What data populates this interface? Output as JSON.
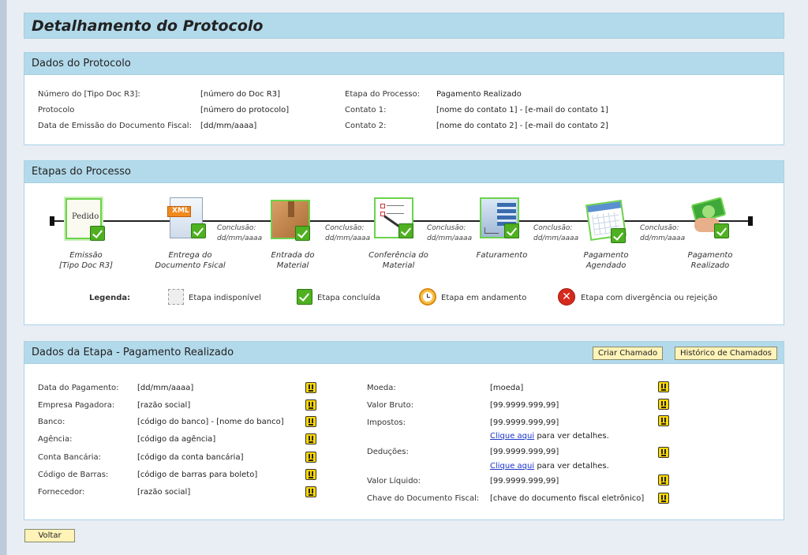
{
  "page": {
    "title": "Detalhamento do Protocolo"
  },
  "protocolo": {
    "header": "Dados do Protocolo",
    "left": [
      {
        "label": "Número do [Tipo Doc R3]:",
        "value": "[número do Doc R3]"
      },
      {
        "label": "Protocolo",
        "value": "[número do protocolo]"
      },
      {
        "label": "Data de Emissão do Documento Fiscal:",
        "value": "[dd/mm/aaaa]"
      }
    ],
    "right": [
      {
        "label": "Etapa do Processo:",
        "value": "Pagamento Realizado"
      },
      {
        "label": "Contato 1:",
        "value": "[nome do contato 1] - [e-mail do contato 1]"
      },
      {
        "label": "Contato 2:",
        "value": "[nome do contato 2] - [e-mail do contato 2]"
      }
    ]
  },
  "etapas": {
    "header": "Etapas do Processo",
    "steps": [
      {
        "label1": "Emissão",
        "label2": "[Tipo Doc R3]",
        "icon": "pedido-icon",
        "icon_text": "Pedido"
      },
      {
        "label1": "Entrega do",
        "label2": "Documento Fsical",
        "icon": "xml-document-icon",
        "icon_text": "XML"
      },
      {
        "label1": "Entrada do",
        "label2": "Material",
        "icon": "box-icon"
      },
      {
        "label1": "Conferência do",
        "label2": "Material",
        "icon": "checklist-icon"
      },
      {
        "label1": "Faturamento",
        "label2": "",
        "icon": "calculator-icon"
      },
      {
        "label1": "Pagamento",
        "label2": "Agendado",
        "icon": "calendar-icon"
      },
      {
        "label1": "Pagamento",
        "label2": "Realizado",
        "icon": "money-hand-icon"
      }
    ],
    "conclusion": {
      "label": "Conclusão:",
      "date": "dd/mm/aaaa"
    },
    "legend": {
      "title": "Legenda:",
      "items": [
        {
          "label": "Etapa indisponível",
          "icon": "unavailable-icon"
        },
        {
          "label": "Etapa concluída",
          "icon": "completed-icon",
          "color": "#4fb021"
        },
        {
          "label": "Etapa em andamento",
          "icon": "clock-icon",
          "color": "#f0a020"
        },
        {
          "label": "Etapa com divergência ou rejeição",
          "icon": "error-icon",
          "color": "#d62a1e"
        }
      ]
    }
  },
  "dados_etapa": {
    "header": "Dados da Etapa - Pagamento Realizado",
    "btn_criar": "Criar Chamado",
    "btn_historico": "Histórico de Chamados",
    "left": [
      {
        "label": "Data do Pagamento:",
        "value": "[dd/mm/aaaa]"
      },
      {
        "label": "Empresa Pagadora:",
        "value": "[razão social]"
      },
      {
        "label": "Banco:",
        "value": "[código do banco] - [nome do banco]"
      },
      {
        "label": "Agência:",
        "value": "[código da agência]"
      },
      {
        "label": "Conta Bancária:",
        "value": "[código da conta bancária]"
      },
      {
        "label": "Código de Barras:",
        "value": "[código de barras para boleto]"
      },
      {
        "label": "Fornecedor:",
        "value": "[razão social]"
      }
    ],
    "right": [
      {
        "label": "Moeda:",
        "value": "[moeda]"
      },
      {
        "label": "Valor Bruto:",
        "value": "[99.9999.999,99]"
      },
      {
        "label": "Impostos:",
        "value": "[99.9999.999,99]"
      },
      {
        "label": "Deduções:",
        "value": "[99.9999.999,99]"
      },
      {
        "label": "Valor Líquido:",
        "value": "[99.9999.999,99]"
      },
      {
        "label": "Chave do Documento Fiscal:",
        "value": "[chave do documento fiscal eletrônico]"
      }
    ],
    "detail_link": "Clique aqui",
    "detail_text": " para ver detalhes."
  },
  "footer": {
    "btn_voltar": "Voltar"
  }
}
